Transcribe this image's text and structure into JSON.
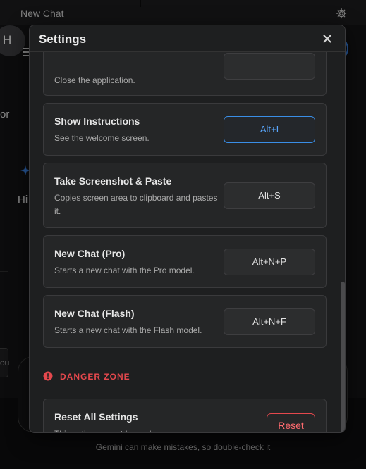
{
  "window": {
    "title": "New Chat",
    "gear_icon": "gear-icon"
  },
  "background": {
    "avatar_letter": "H",
    "fragment_or": "or",
    "fragment_hi": "Hi",
    "fragment_ou": "ou",
    "disclaimer": "Gemini can make mistakes, so double-check it"
  },
  "settings": {
    "title": "Settings",
    "close_icon": "close-icon",
    "partial_item": {
      "desc": "Close the application."
    },
    "shortcuts": [
      {
        "title": "Show Instructions",
        "desc": "See the welcome screen.",
        "key": "Alt+I",
        "state": "active"
      },
      {
        "title": "Take Screenshot & Paste",
        "desc": "Copies screen area to clipboard and pastes it.",
        "key": "Alt+S",
        "state": "normal"
      },
      {
        "title": "New Chat (Pro)",
        "desc": "Starts a new chat with the Pro model.",
        "key": "Alt+N+P",
        "state": "normal"
      },
      {
        "title": "New Chat (Flash)",
        "desc": "Starts a new chat with the Flash model.",
        "key": "Alt+N+F",
        "state": "normal"
      }
    ],
    "danger_zone": {
      "label": "DANGER ZONE",
      "icon": "alert-circle-icon",
      "reset": {
        "title": "Reset All Settings",
        "desc": "This action cannot be undone.",
        "button_label": "Reset"
      }
    }
  },
  "colors": {
    "accent_blue": "#3a8ee6",
    "danger_red": "#e5484d",
    "dialog_bg": "#1e1f20",
    "card_bg": "#252627"
  }
}
